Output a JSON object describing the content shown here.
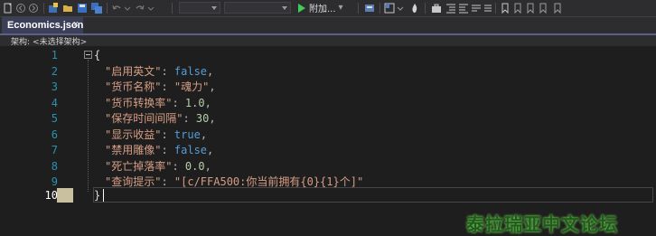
{
  "toolbar": {
    "attach_label": "附加...",
    "attach_arrow": "▾",
    "icons": [
      "new-file-icon",
      "open-icon",
      "save-icon",
      "save-all-icon",
      "undo-icon",
      "redo-icon",
      "run-icon",
      "breakpoints-icon",
      "tools-icon",
      "bookmark-icon"
    ]
  },
  "tabs": [
    {
      "label": "Economics.json",
      "active": true,
      "close_glyph": "×"
    }
  ],
  "arch_bar": {
    "label": "架构:",
    "value": "<未选择架构>"
  },
  "editor": {
    "line_numbers": [
      "1",
      "2",
      "3",
      "4",
      "5",
      "6",
      "7",
      "8",
      "9",
      "10"
    ],
    "current_line": "10",
    "open_brace": "{",
    "close_brace": "}",
    "entries": [
      {
        "key": "\"启用英文\"",
        "sep": ": ",
        "value": "false",
        "kind": "kw",
        "trail": ","
      },
      {
        "key": "\"货币名称\"",
        "sep": ": ",
        "value": "\"魂力\"",
        "kind": "str",
        "trail": ","
      },
      {
        "key": "\"货币转换率\"",
        "sep": ": ",
        "value": "1.0",
        "kind": "num",
        "trail": ","
      },
      {
        "key": "\"保存时间间隔\"",
        "sep": ": ",
        "value": "30",
        "kind": "num",
        "trail": ","
      },
      {
        "key": "\"显示收益\"",
        "sep": ": ",
        "value": "true",
        "kind": "kw",
        "trail": ","
      },
      {
        "key": "\"禁用雕像\"",
        "sep": ": ",
        "value": "false",
        "kind": "kw",
        "trail": ","
      },
      {
        "key": "\"死亡掉落率\"",
        "sep": ": ",
        "value": "0.0",
        "kind": "num",
        "trail": ","
      },
      {
        "key": "\"查询提示\"",
        "sep": ": ",
        "value": "\"[c/FFA500:你当前拥有{0}{1}个]\"",
        "kind": "str",
        "trail": ""
      }
    ]
  },
  "colors": {
    "string": "#d69d85",
    "keyword": "#569cd6",
    "number": "#b5cea8",
    "line_number": "#2b91af",
    "background": "#1e1e1e",
    "tab_active": "#3c3f58"
  },
  "watermark": "泰拉瑞亚中文论坛"
}
